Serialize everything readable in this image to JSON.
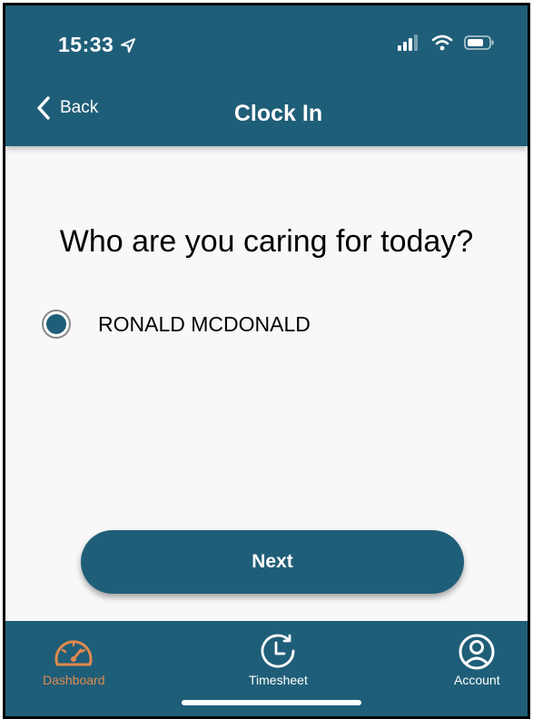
{
  "status_bar": {
    "time": "15:33"
  },
  "nav": {
    "back_label": "Back",
    "title": "Clock In"
  },
  "content": {
    "question": "Who are you caring for today?",
    "options": [
      {
        "label": "RONALD MCDONALD",
        "selected": true
      }
    ]
  },
  "actions": {
    "next_label": "Next"
  },
  "tabbar": {
    "items": [
      {
        "label": "Dashboard",
        "icon": "speedometer-icon",
        "active": true
      },
      {
        "label": "Timesheet",
        "icon": "clock-icon",
        "active": false
      },
      {
        "label": "Account",
        "icon": "user-circle-icon",
        "active": false
      }
    ]
  },
  "colors": {
    "primary": "#1f5e78",
    "active_tab": "#e08a4e",
    "background": "#f8f8f8"
  }
}
